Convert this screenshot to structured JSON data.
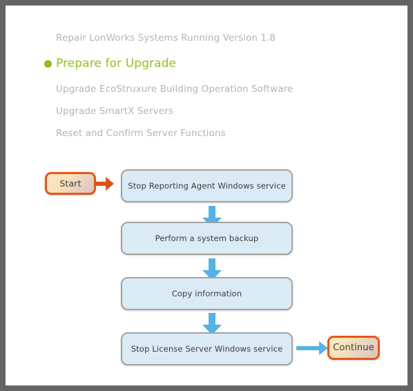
{
  "frame": {
    "border_color": "#636466",
    "background": "#ffffff"
  },
  "colors": {
    "accent_green": "#93c01f",
    "inactive_gray": "#b4b4b4",
    "box_fill": "#dbebf6",
    "box_border": "#a3a3a3",
    "blue_arrow": "#54b3e4",
    "orange_arrow": "#d9541c",
    "terminator_border": "#e4571a",
    "body_text": "#3c3c3c"
  },
  "step_list": {
    "items": [
      {
        "label": "Repair LonWorks Systems Running Version 1.8",
        "active": false
      },
      {
        "label": "Prepare for Upgrade",
        "active": true
      },
      {
        "label": "Upgrade EcoStruxure Building Operation Software",
        "active": false
      },
      {
        "label": "Upgrade SmartX Servers",
        "active": false
      },
      {
        "label": "Reset and Confirm Server Functions",
        "active": false
      }
    ]
  },
  "flowchart": {
    "start_label": "Start",
    "continue_label": "Continue",
    "steps": [
      {
        "label": "Stop Reporting Agent Windows service"
      },
      {
        "label": "Perform a system backup"
      },
      {
        "label": "Copy information"
      },
      {
        "label": "Stop License Server Windows service"
      }
    ],
    "connectors": [
      {
        "name": "start-arrow",
        "direction": "right",
        "color": "#d9541c"
      },
      {
        "name": "arrow-down-1",
        "direction": "down",
        "color": "#54b3e4"
      },
      {
        "name": "arrow-down-2",
        "direction": "down",
        "color": "#54b3e4"
      },
      {
        "name": "arrow-down-3",
        "direction": "down",
        "color": "#54b3e4"
      },
      {
        "name": "continue-arrow",
        "direction": "right",
        "color": "#54b3e4"
      }
    ]
  }
}
